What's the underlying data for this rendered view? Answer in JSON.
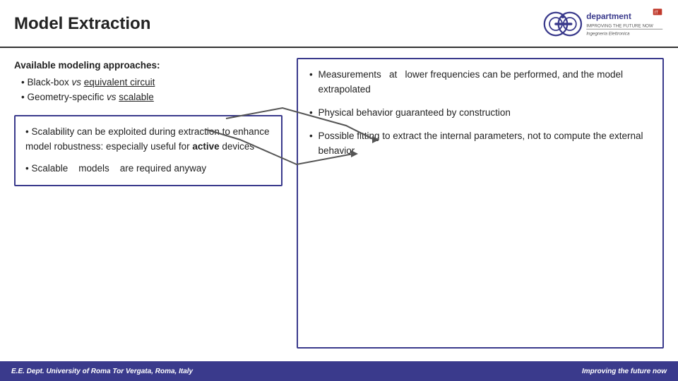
{
  "header": {
    "title": "Model Extraction"
  },
  "approaches": {
    "heading": "Available modeling approaches:",
    "items": [
      {
        "label": "Black-box ",
        "italic": "vs",
        "rest": " ",
        "underline": "equivalent circuit"
      },
      {
        "label": "Geometry-specific ",
        "italic": "vs",
        "rest": " ",
        "underline": "scalable"
      }
    ]
  },
  "left_box": {
    "bullets": [
      "Scalability can be exploited during extraction to enhance model robustness: especially useful for active devices",
      "Scalable models are required anyway"
    ]
  },
  "right_box": {
    "bullets": [
      "Measurements at lower frequencies can be performed, and the model extrapolated",
      "Physical behavior guaranteed by construction",
      "Possible fitting to extract the internal parameters, not to compute the external behavior"
    ]
  },
  "footer": {
    "left": "E.E. Dept. University of Roma Tor Vergata, Roma, Italy",
    "right": "Improving the future now"
  },
  "logo": {
    "alt": "Department Logo - Improving the Future Now"
  }
}
